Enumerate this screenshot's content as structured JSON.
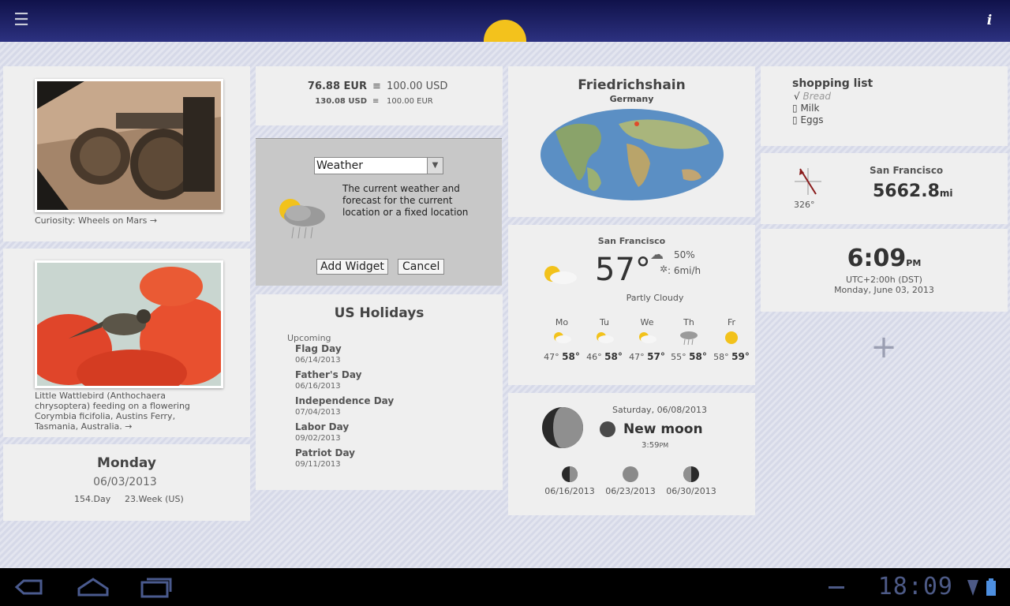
{
  "topbar": {
    "menu_icon": "menu-icon",
    "info_icon": "info-icon",
    "info_label": "i"
  },
  "photo1": {
    "caption": "Curiosity: Wheels on Mars →"
  },
  "photo2": {
    "caption": "Little Wattlebird (Anthochaera chrysoptera) feeding on a flowering Corymbia ficifolia, Austins Ferry, Tasmania, Australia. →"
  },
  "date_widget": {
    "weekday": "Monday",
    "date": "06/03/2013",
    "day_of_year": "154.Day",
    "week": "23.Week (US)"
  },
  "currency": {
    "row1_left": "76.88 EUR",
    "row1_sym": "≡",
    "row1_right": "100.00 USD",
    "row2_left": "130.08 USD",
    "row2_sym": "≡",
    "row2_right": "100.00 EUR"
  },
  "widget_picker": {
    "selected": "Weather",
    "description": "The current weather and forecast for the current location or a fixed location",
    "add_label": "Add Widget",
    "cancel_label": "Cancel"
  },
  "holidays": {
    "title": "US Holidays",
    "section": "Upcoming",
    "items": [
      {
        "name": "Flag Day",
        "date": "06/14/2013"
      },
      {
        "name": "Father's Day",
        "date": "06/16/2013"
      },
      {
        "name": "Independence Day",
        "date": "07/04/2013"
      },
      {
        "name": "Labor Day",
        "date": "09/02/2013"
      },
      {
        "name": "Patriot Day",
        "date": "09/11/2013"
      }
    ]
  },
  "worldclock": {
    "city": "Friedrichshain",
    "country": "Germany"
  },
  "weather": {
    "city": "San Francisco",
    "temp": "57°",
    "humidity": "50%",
    "wind": ": 6mi/h",
    "condition": "Partly Cloudy",
    "forecast": [
      {
        "day": "Mo",
        "low": "47°",
        "high": "58°",
        "icon": "partly-cloudy"
      },
      {
        "day": "Tu",
        "low": "46°",
        "high": "58°",
        "icon": "partly-cloudy"
      },
      {
        "day": "We",
        "low": "47°",
        "high": "57°",
        "icon": "partly-cloudy"
      },
      {
        "day": "Th",
        "low": "55°",
        "high": "58°",
        "icon": "rain"
      },
      {
        "day": "Fr",
        "low": "58°",
        "high": "59°",
        "icon": "sunny"
      }
    ]
  },
  "moon": {
    "date": "Saturday, 06/08/2013",
    "phase": "New moon",
    "time": "3:59",
    "time_suffix": "PM",
    "upcoming": [
      {
        "date": "06/16/2013",
        "icon": "first-quarter"
      },
      {
        "date": "06/23/2013",
        "icon": "full-moon"
      },
      {
        "date": "06/30/2013",
        "icon": "last-quarter"
      }
    ]
  },
  "shopping": {
    "title": "shopping list",
    "items": [
      {
        "mark": "√",
        "label": "Bread",
        "done": true
      },
      {
        "mark": "▯",
        "label": "Milk",
        "done": false
      },
      {
        "mark": "▯",
        "label": "Eggs",
        "done": false
      }
    ]
  },
  "compass": {
    "bearing": "326°",
    "city": "San Francisco",
    "distance": "5662.8",
    "unit": "mi"
  },
  "clock_widget": {
    "time": "6:09",
    "ampm": "PM",
    "utc": "UTC+2:00h (DST)",
    "date": "Monday, June 03, 2013"
  },
  "add_widget": {
    "label": "+"
  },
  "navbar": {
    "clock": "18:09"
  }
}
